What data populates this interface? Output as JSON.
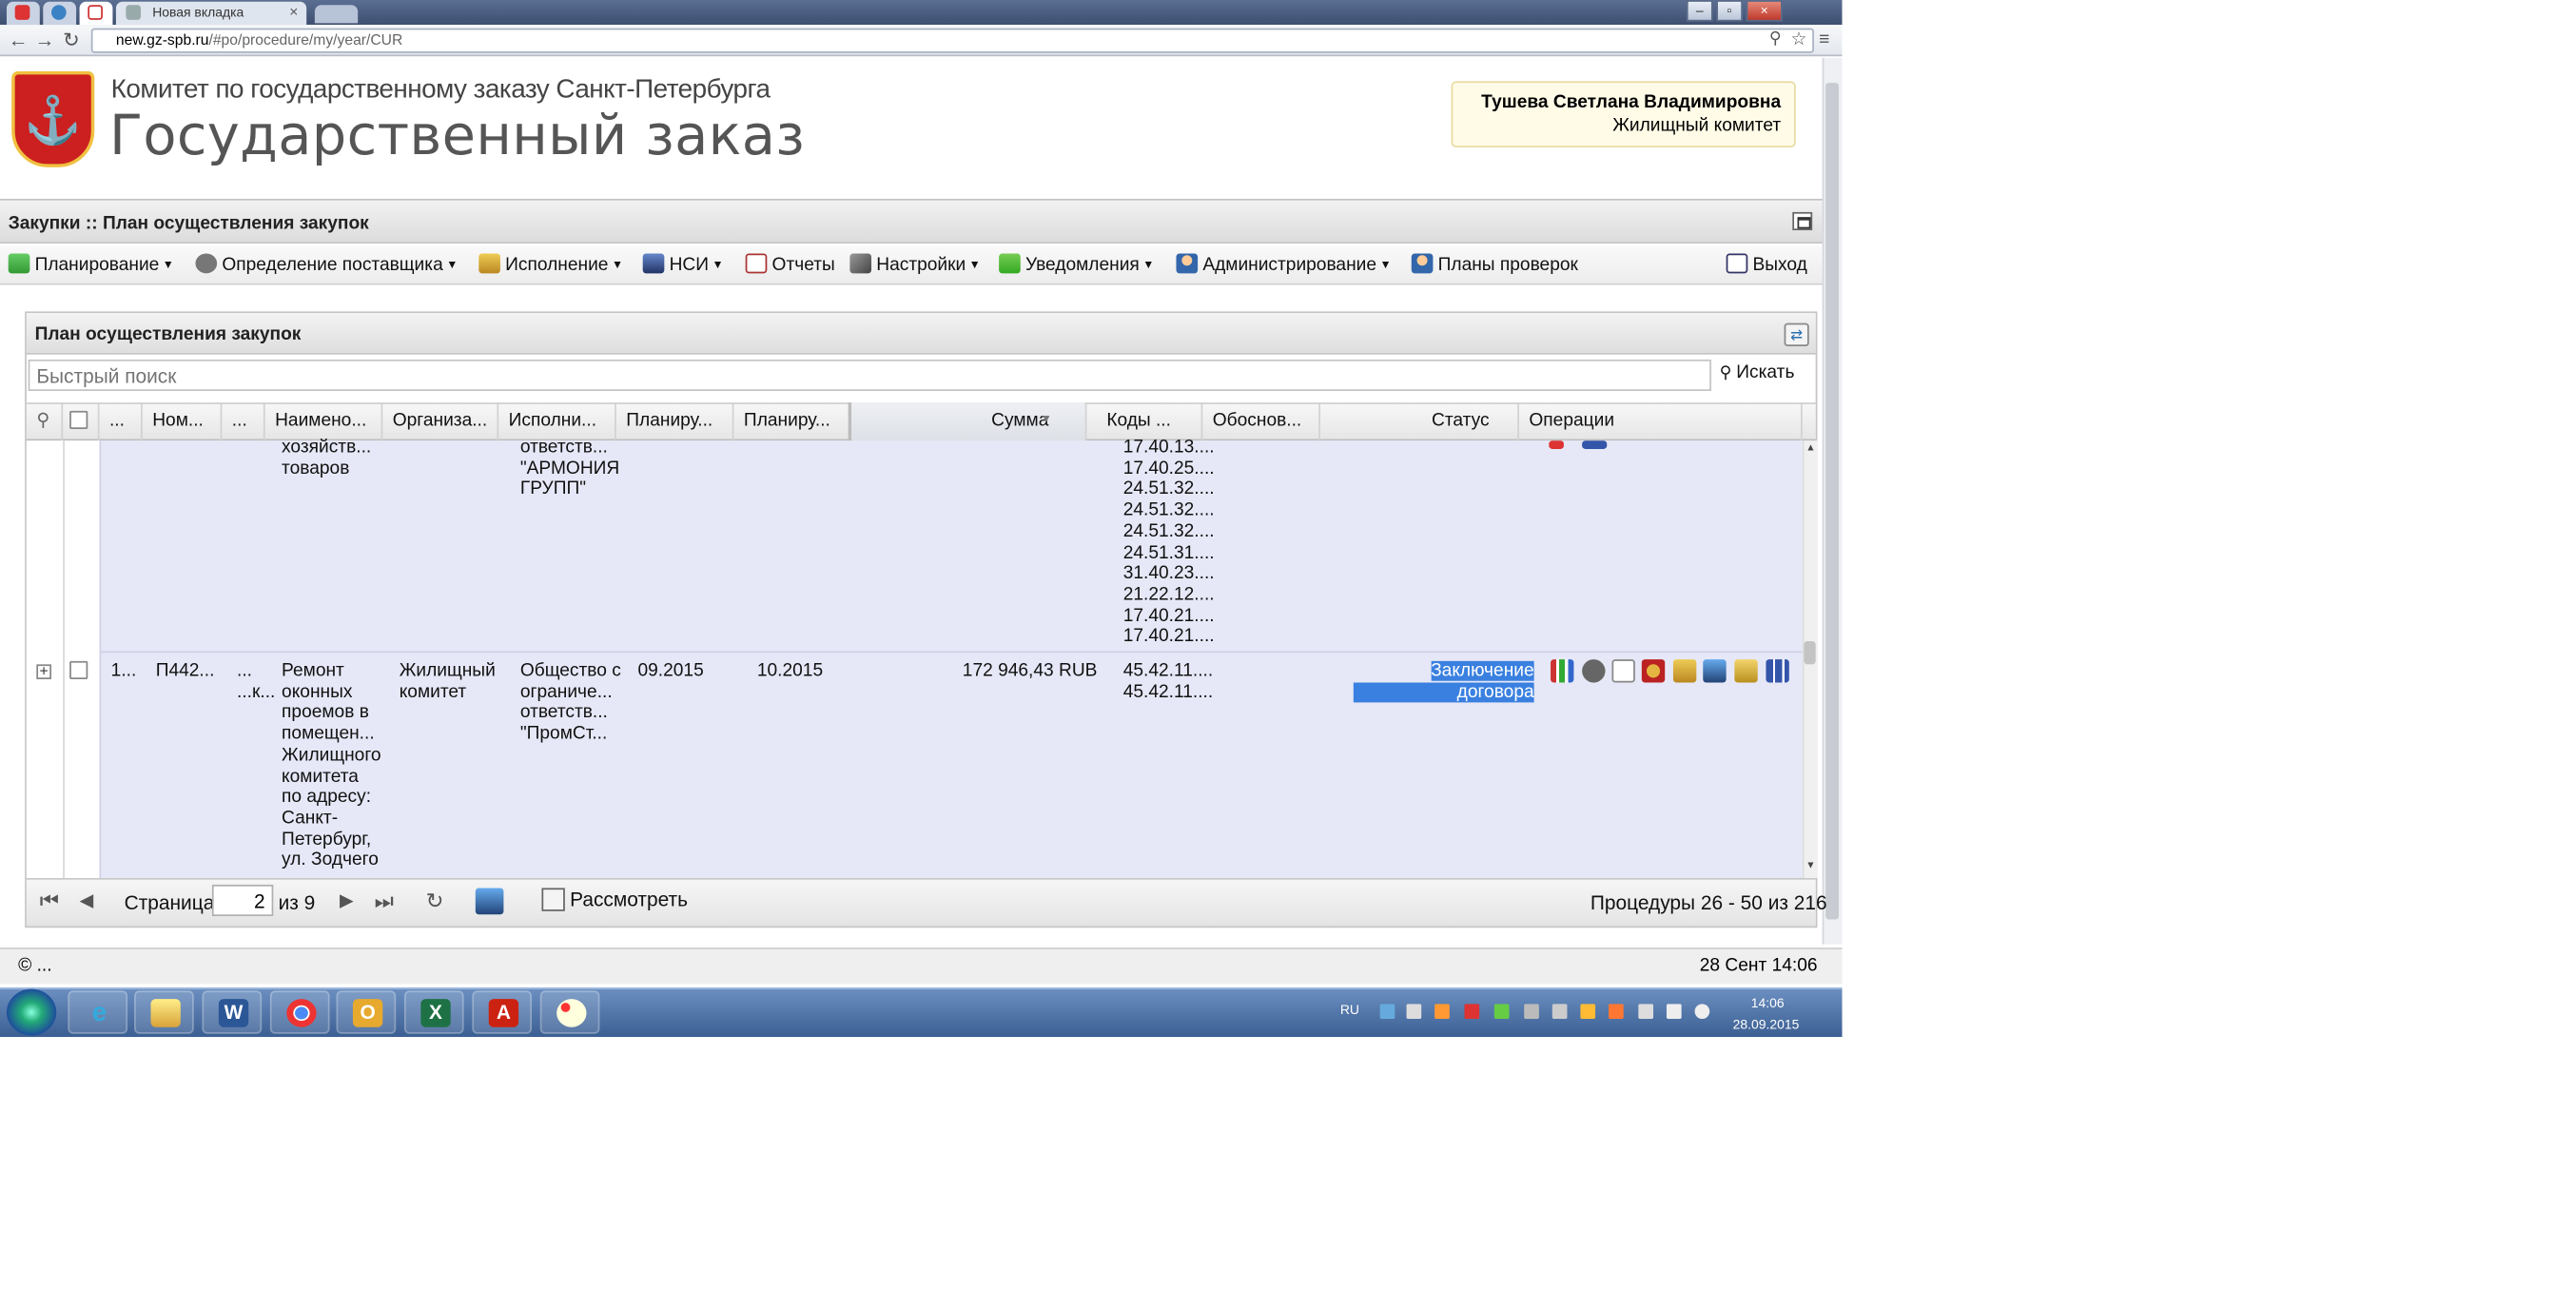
{
  "browser": {
    "tab_label": "Новая вкладка",
    "url_host": "new.gz-spb.ru",
    "url_path": "/#po/procedure/my/year/CUR"
  },
  "header": {
    "org_line1": "Комитет по государственному заказу Санкт-Петербурга",
    "org_line2": "Государственный заказ",
    "user_name": "Тушева Светлана Владимировна",
    "user_org": "Жилищный комитет"
  },
  "panel_title": "Закупки :: План осуществления закупок",
  "menu": {
    "items": [
      "Планирование",
      "Определение поставщика",
      "Исполнение",
      "НСИ",
      "Отчеты",
      "Настройки",
      "Уведомления",
      "Администрирование",
      "Планы проверок"
    ],
    "exit": "Выход"
  },
  "grid": {
    "title": "План осуществления закупок",
    "search_placeholder": "Быстрый поиск",
    "search_button": "Искать",
    "columns": [
      "...",
      "Ном...",
      "...",
      "Наимено...",
      "Организа...",
      "Исполни...",
      "Планиру...",
      "Планиру...",
      "Сумма",
      "Коды ...",
      "Обоснов...",
      "Статус",
      "Операции"
    ],
    "row_prev": {
      "name_lines": [
        "хозяйств...",
        "товаров"
      ],
      "executor_lines": [
        "ответств...",
        "\"АРМОНИЯ",
        "ГРУПП\""
      ],
      "codes": [
        "17.40.13....",
        "17.40.25....",
        "24.51.32....",
        "24.51.32....",
        "24.51.32....",
        "24.51.31....",
        "31.40.23....",
        "21.22.12....",
        "17.40.21....",
        "17.40.21...."
      ]
    },
    "row_main": {
      "col1": "1...",
      "number": "П442...",
      "col3_lines": [
        "...",
        "...к..."
      ],
      "name_lines": [
        "Ремонт",
        "оконных",
        "проемов в",
        "помещен...",
        "Жилищного",
        "комитета",
        "по адресу:",
        "Санкт-",
        "Петербург,",
        "ул. Зодчего"
      ],
      "org_lines": [
        "Жилищный",
        "комитет"
      ],
      "executor_lines": [
        "Общество с",
        "ограниче...",
        "ответств...",
        "\"ПромСт..."
      ],
      "plan1": "09.2015",
      "plan2": "10.2015",
      "sum": "172 946,43 RUB",
      "codes": [
        "45.42.11....",
        "45.42.11...."
      ],
      "status_lines": [
        "Заключение",
        "договора"
      ]
    }
  },
  "paging": {
    "page_label": "Страница",
    "page_value": "2",
    "of_label": "из 9",
    "view_button": "Рассмотреть",
    "summary": "Процедуры 26 - 50 из 216"
  },
  "footer": {
    "copyright": "© ...",
    "datetime": "28 Сент 14:06"
  },
  "taskbar": {
    "lang": "RU",
    "time": "14:06",
    "date": "28.09.2015"
  },
  "colors": {
    "row_bg": "#e6e8f7",
    "status_highlight": "#3a80e0",
    "taskbar": "#3c5f93"
  }
}
